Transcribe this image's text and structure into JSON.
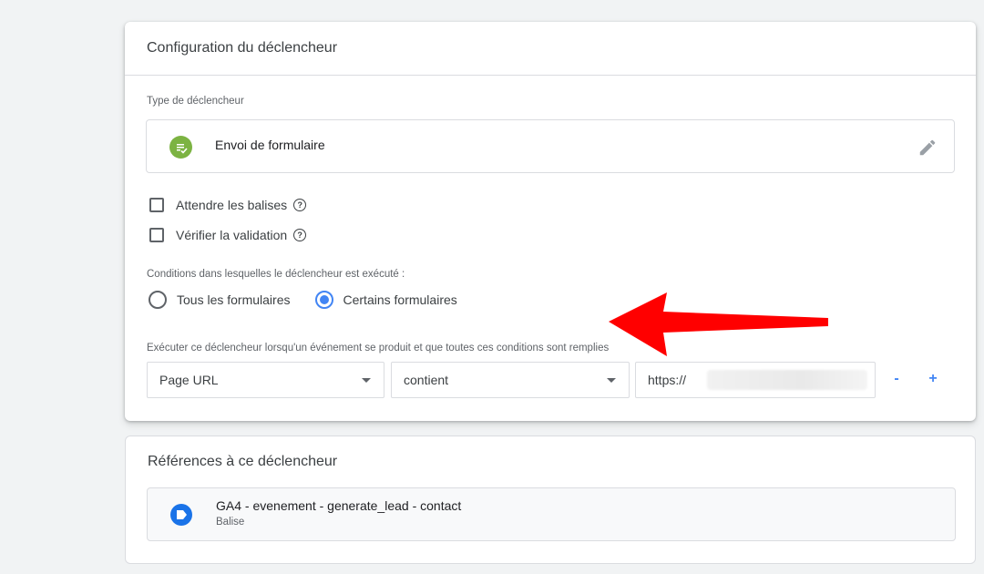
{
  "config": {
    "title": "Configuration du déclencheur",
    "type_label": "Type de déclencheur",
    "type_value": "Envoi de formulaire",
    "type_icon": "form-submit-icon",
    "edit_icon": "pencil-icon",
    "checkboxes": [
      {
        "label": "Attendre les balises",
        "checked": false
      },
      {
        "label": "Vérifier la validation",
        "checked": false
      }
    ],
    "conditions_label": "Conditions dans lesquelles le déclencheur est exécuté :",
    "radios": [
      {
        "label": "Tous les formulaires",
        "checked": false
      },
      {
        "label": "Certains formulaires",
        "checked": true
      }
    ],
    "rule_label": "Exécuter ce déclencheur lorsqu'un événement se produit et que toutes ces conditions sont remplies",
    "rule": {
      "variable": "Page URL",
      "operator": "contient",
      "value": "https://"
    },
    "minus": "-",
    "plus": "+",
    "accent_color": "#4285f4",
    "annotation_color": "#ff0000"
  },
  "references": {
    "title": "Références à ce déclencheur",
    "items": [
      {
        "name": "GA4 - evenement - generate_lead - contact",
        "kind": "Balise",
        "icon": "tag-icon"
      }
    ]
  }
}
